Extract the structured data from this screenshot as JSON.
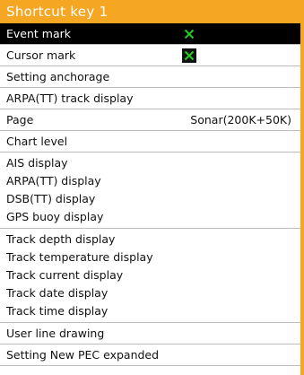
{
  "title": "Shortcut key 1",
  "items": [
    {
      "label": "Event mark",
      "checked": true
    },
    {
      "label": "Cursor mark",
      "checked": true
    },
    {
      "label": "Setting anchorage"
    },
    {
      "label": "ARPA(TT) track display"
    },
    {
      "label": "Page",
      "value": "Sonar(200K+50K)"
    },
    {
      "label": "Chart level"
    },
    {
      "lines": [
        "AIS display",
        "ARPA(TT) display",
        "DSB(TT) display",
        "GPS buoy display"
      ]
    },
    {
      "lines": [
        "Track depth display",
        "Track temperature display",
        "Track current display",
        "Track date display",
        "Track time display"
      ]
    },
    {
      "label": "User line drawing"
    },
    {
      "label": "Setting New PEC expanded"
    }
  ],
  "colors": {
    "accent": "#f5a623",
    "check": "#22cc22",
    "selected_bg": "#000000"
  },
  "icons": {
    "check": "checkmark-icon"
  }
}
